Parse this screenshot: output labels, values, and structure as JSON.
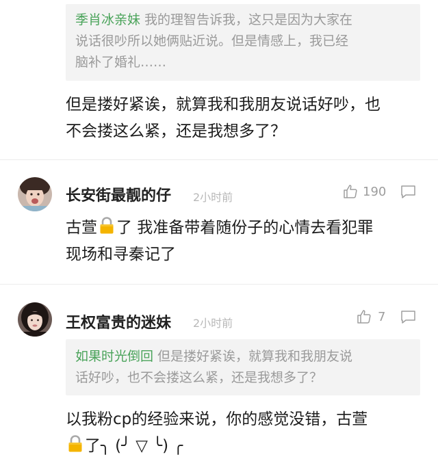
{
  "comments": [
    {
      "quote": {
        "name": "季肖冰亲妹",
        "line1": "我的理智告诉我，这只是因为大家在",
        "line2": "说话很吵所以她俩贴近说。但是情感上，我已经",
        "line3": "脑补了婚礼……"
      },
      "body": {
        "line1": "但是搂好紧诶，就算我和我朋友说话好吵，也",
        "line2": "不会搂这么紧，还是我想多了？"
      }
    },
    {
      "username": "长安街最靓的仔",
      "time": "2小时前",
      "likes": "190",
      "body": {
        "line1_prefix": "古萱",
        "line1_suffix": "了 我准备带着随份子的心情去看犯罪",
        "line2": "现场和寻秦记了"
      }
    },
    {
      "username": "王权富贵的迷妹",
      "time": "2小时前",
      "likes": "7",
      "quote": {
        "name": "如果时光倒回",
        "line1": "但是搂好紧诶，就算我和我朋友说",
        "line2": "话好吵，也不会搂这么紧，还是我想多了？"
      },
      "body": {
        "line1": "以我粉cp的经验来说，你的感觉没错，古萱",
        "line2_suffix": "了╮ (╯ ▽ ╰) ╭"
      }
    }
  ],
  "icons": {
    "like": "thumbs-up-icon",
    "reply": "comment-icon",
    "lock": "lock-emoji-icon"
  },
  "colors": {
    "quote_name": "#4aa35a",
    "quote_text": "#9a9a9a",
    "quote_bg": "#f3f3f3",
    "lock_body": "#f4b400"
  }
}
